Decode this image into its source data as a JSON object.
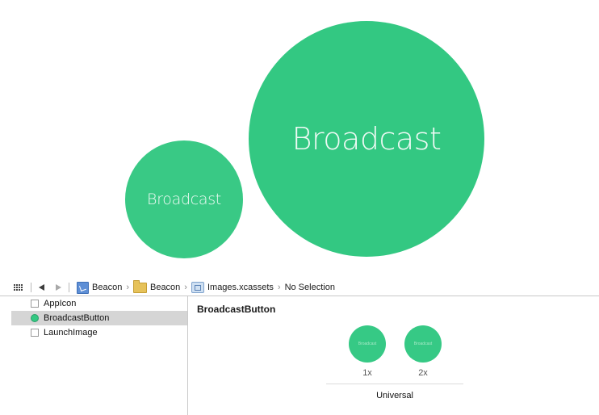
{
  "preview": {
    "small_label": "Broadcast",
    "large_label": "Broadcast",
    "circle_color": "#33c882"
  },
  "jumpbar": {
    "crumbs": [
      "Beacon",
      "Beacon",
      "Images.xcassets",
      "No Selection"
    ]
  },
  "asset_list": {
    "items": [
      {
        "label": "AppIcon",
        "selected": false
      },
      {
        "label": "BroadcastButton",
        "selected": true
      },
      {
        "label": "LaunchImage",
        "selected": false
      }
    ]
  },
  "detail": {
    "title": "BroadcastButton",
    "slots": [
      {
        "thumb_label": "Broadcast",
        "scale": "1x"
      },
      {
        "thumb_label": "Broadcast",
        "scale": "2x"
      }
    ],
    "idiom": "Universal"
  }
}
